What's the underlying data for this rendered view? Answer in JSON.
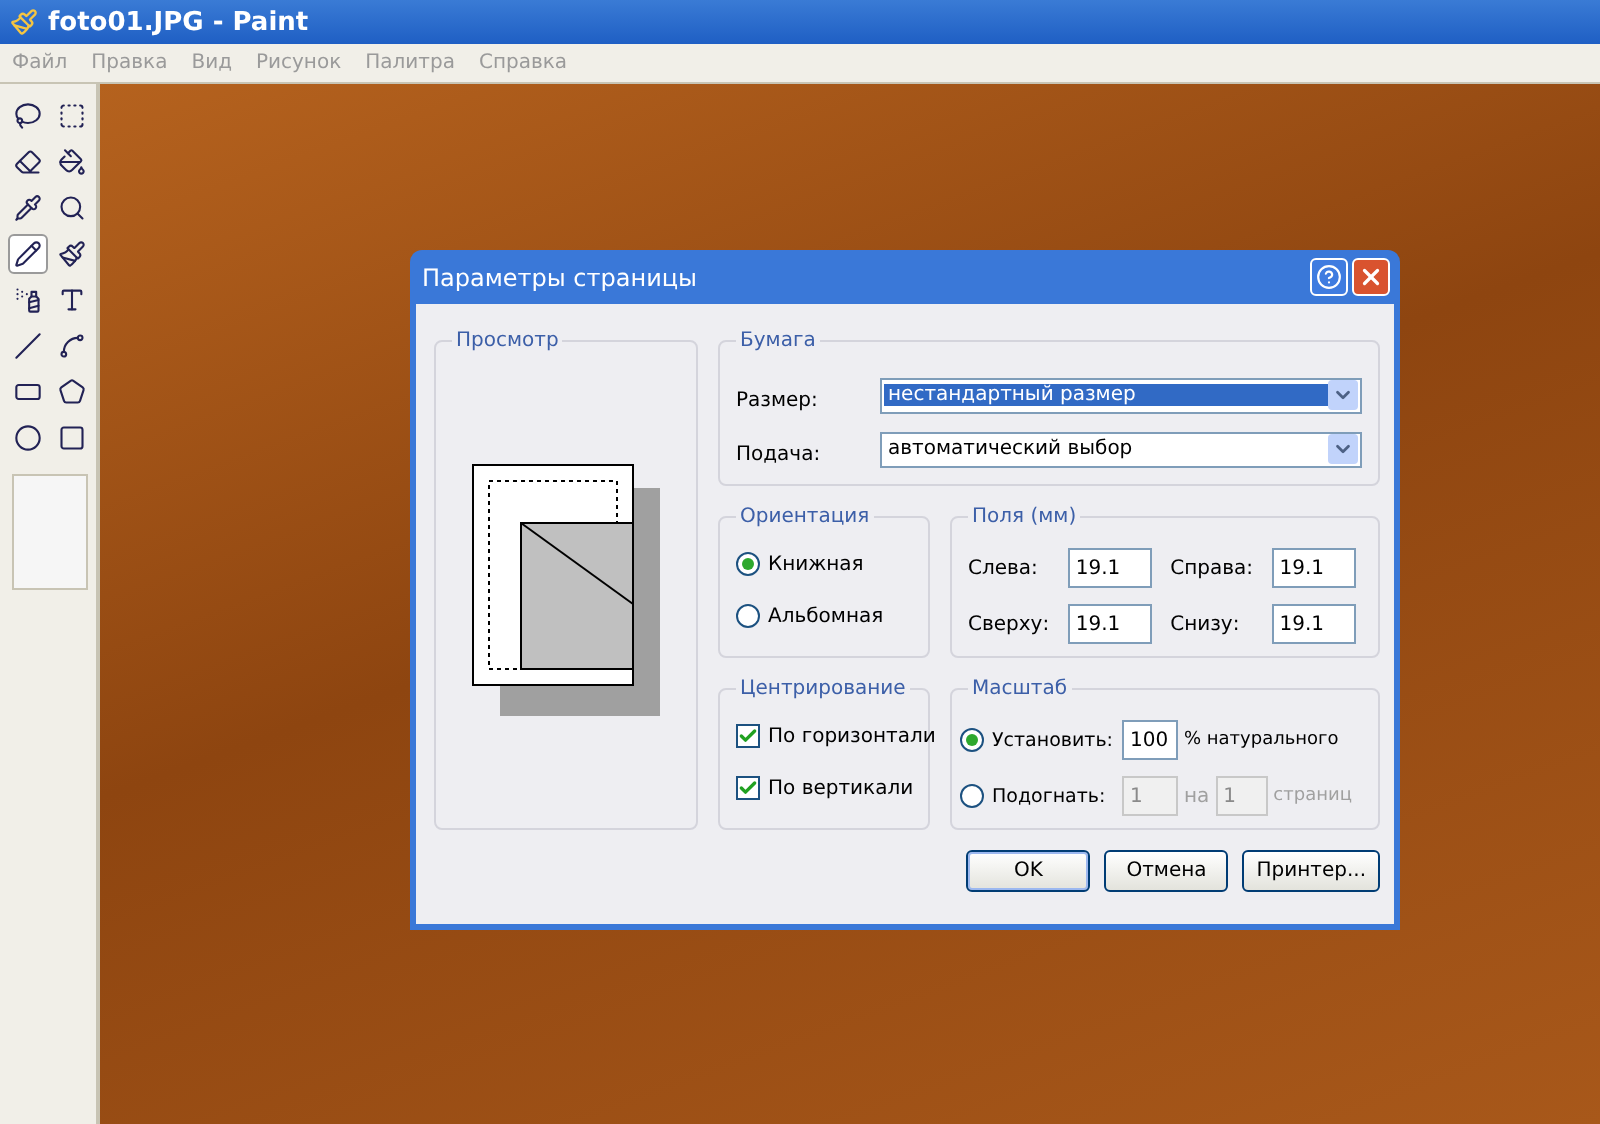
{
  "window": {
    "title": "foto01.JPG - Paint"
  },
  "menu": [
    "Файл",
    "Правка",
    "Вид",
    "Рисунок",
    "Палитра",
    "Справка"
  ],
  "tools": [
    {
      "kind": "lasso",
      "selected": false
    },
    {
      "kind": "select",
      "selected": false
    },
    {
      "kind": "eraser",
      "selected": false
    },
    {
      "kind": "fill",
      "selected": false
    },
    {
      "kind": "picker",
      "selected": false
    },
    {
      "kind": "zoom",
      "selected": false
    },
    {
      "kind": "pencil",
      "selected": true
    },
    {
      "kind": "brush",
      "selected": false
    },
    {
      "kind": "spray",
      "selected": false
    },
    {
      "kind": "text",
      "selected": false
    },
    {
      "kind": "line",
      "selected": false
    },
    {
      "kind": "curve",
      "selected": false
    },
    {
      "kind": "rect",
      "selected": false
    },
    {
      "kind": "polygon",
      "selected": false
    },
    {
      "kind": "ellipse",
      "selected": false
    },
    {
      "kind": "roundrect",
      "selected": false
    }
  ],
  "dialog": {
    "title": "Параметры страницы",
    "preview": {
      "title": "Просмотр"
    },
    "paper": {
      "title": "Бумага",
      "fields": [
        {
          "label": "Размер:",
          "value": "нестандартный размер",
          "selected": true
        },
        {
          "label": "Подача:",
          "value": "автоматический выбор",
          "selected": false
        }
      ]
    },
    "orientation": {
      "title": "Ориентация",
      "options": [
        {
          "label": "Книжная",
          "selected": true
        },
        {
          "label": "Альбомная",
          "selected": false
        }
      ]
    },
    "margins": {
      "title": "Поля (мм)",
      "fields": [
        {
          "label": "Слева:",
          "value": "19.1"
        },
        {
          "label": "Справа:",
          "value": "19.1"
        },
        {
          "label": "Сверху:",
          "value": "19.1"
        },
        {
          "label": "Снизу:",
          "value": "19.1"
        }
      ]
    },
    "centering": {
      "title": "Центрирование",
      "options": [
        {
          "label": "По горизонтали",
          "checked": true
        },
        {
          "label": "По вертикали",
          "checked": true
        }
      ]
    },
    "scale": {
      "title": "Масштаб",
      "options": [
        {
          "label": "Установить:",
          "selected": true,
          "disabled": false,
          "value": "100",
          "suffix": "% натурального"
        },
        {
          "label": "Подогнать:",
          "selected": false,
          "disabled": true,
          "value": "1",
          "middle": "на",
          "value2": "1",
          "suffix": "страниц"
        }
      ]
    },
    "buttons": [
      {
        "label": "OK",
        "default": true
      },
      {
        "label": "Отмена",
        "default": false
      },
      {
        "label": "Принтер...",
        "default": false
      }
    ]
  }
}
